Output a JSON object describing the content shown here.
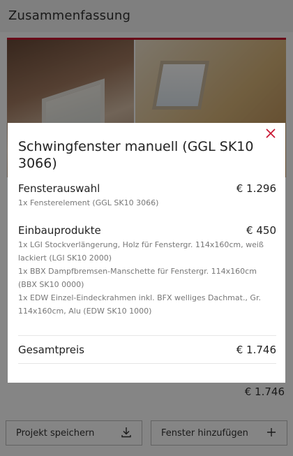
{
  "page": {
    "title": "Zusammenfassung"
  },
  "background": {
    "total_price": "€ 1.746"
  },
  "bottom_bar": {
    "save_label": "Projekt speichern",
    "save_icon": "download-icon",
    "add_label": "Fenster hinzufügen",
    "add_icon": "plus-icon"
  },
  "modal": {
    "title": "Schwingfenster manuell (GGL SK10 3066)",
    "close_icon": "close-icon",
    "sections": [
      {
        "label": "Fensterauswahl",
        "price": "€ 1.296",
        "items": [
          "1x Fensterelement (GGL SK10 3066)"
        ]
      },
      {
        "label": "Einbauprodukte",
        "price": "€ 450",
        "items": [
          "1x LGI Stockverlängerung, Holz für Fenstergr. 114x160cm, weiß lackiert (LGI SK10 2000)",
          "1x BBX Dampfbremsen-Manschette für Fenstergr. 114x160cm (BBX SK10 0000)",
          "1x EDW Einzel-Eindeckrahmen inkl. BFX welliges Dachmat., Gr. 114x160cm, Alu (EDW SK10 1000)"
        ]
      }
    ],
    "total_label": "Gesamtpreis",
    "total_price": "€ 1.746"
  },
  "colors": {
    "accent": "#c8102e"
  }
}
